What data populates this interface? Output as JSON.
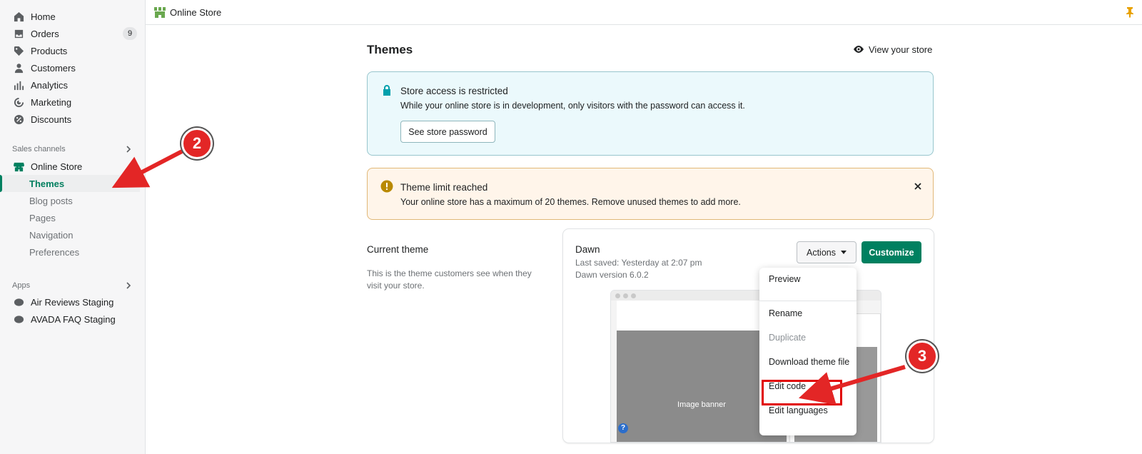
{
  "sidebar": {
    "nav": [
      {
        "label": "Home",
        "icon": "home-icon"
      },
      {
        "label": "Orders",
        "icon": "orders-icon",
        "badge": "9"
      },
      {
        "label": "Products",
        "icon": "tag-icon"
      },
      {
        "label": "Customers",
        "icon": "person-icon"
      },
      {
        "label": "Analytics",
        "icon": "bar-chart-icon"
      },
      {
        "label": "Marketing",
        "icon": "target-icon"
      },
      {
        "label": "Discounts",
        "icon": "discount-icon"
      }
    ],
    "sales_channels_label": "Sales channels",
    "online_store_label": "Online Store",
    "sub_items": [
      "Themes",
      "Blog posts",
      "Pages",
      "Navigation",
      "Preferences"
    ],
    "apps_label": "Apps",
    "apps": [
      "Air Reviews Staging",
      "AVADA FAQ Staging"
    ]
  },
  "topbar": {
    "title": "Online Store"
  },
  "main": {
    "title": "Themes",
    "view_store": "View your store",
    "info_banner": {
      "title": "Store access is restricted",
      "text": "While your online store is in development, only visitors with the password can access it.",
      "button": "See store password"
    },
    "warn_banner": {
      "title": "Theme limit reached",
      "text": "Your online store has a maximum of 20 themes. Remove unused themes to add more."
    },
    "current_theme": {
      "label": "Current theme",
      "description": "This is the theme customers see when they visit your store.",
      "name": "Dawn",
      "last_saved": "Last saved: Yesterday at 2:07 pm",
      "version": "Dawn version 6.0.2",
      "actions_label": "Actions",
      "customize_label": "Customize",
      "preview_banner_text": "Image banner"
    },
    "actions_menu": [
      "Preview",
      "Rename",
      "Duplicate",
      "Download theme file",
      "Edit code",
      "Edit languages"
    ]
  },
  "annotations": {
    "marker_2": "2",
    "marker_3": "3"
  },
  "colors": {
    "accent": "#008060",
    "annotation_red": "#e32626"
  }
}
